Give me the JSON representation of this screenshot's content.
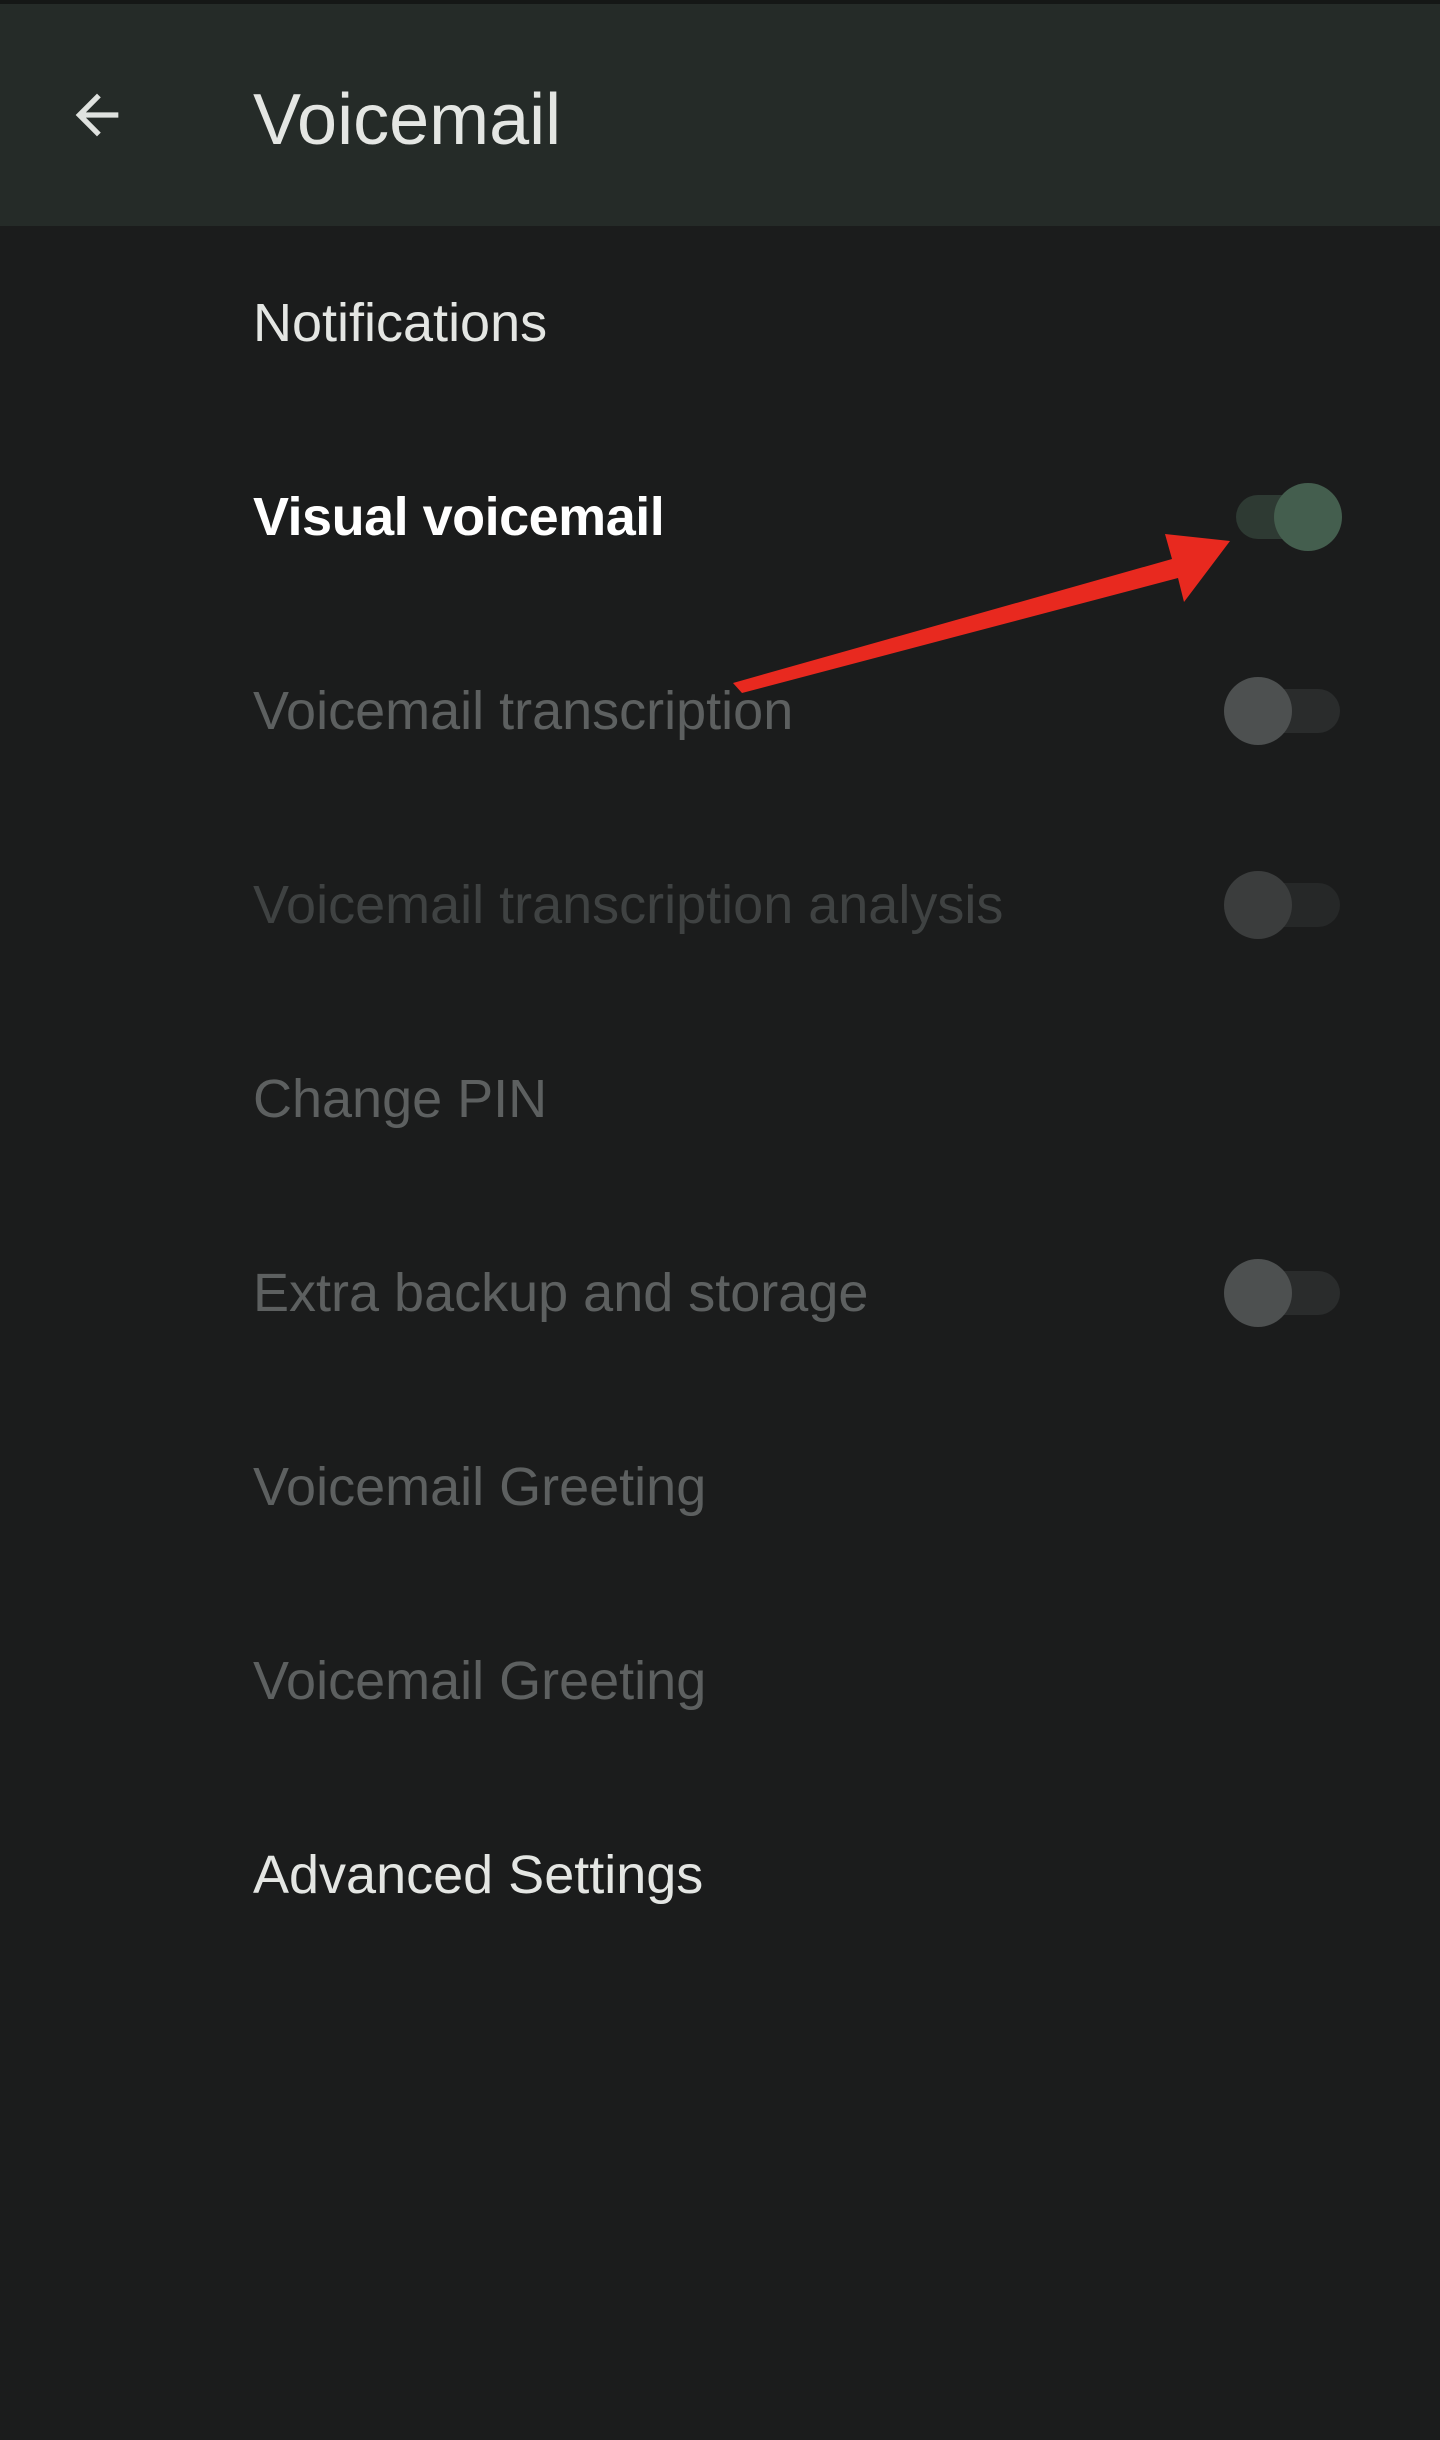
{
  "app_bar": {
    "title": "Voicemail",
    "back_icon": "arrow-back-icon"
  },
  "settings": {
    "notifications": {
      "label": "Notifications"
    },
    "visual_voicemail": {
      "label": "Visual voicemail",
      "enabled": true
    },
    "voicemail_transcription": {
      "label": "Voicemail transcription",
      "enabled": false
    },
    "voicemail_transcription_analysis": {
      "label": "Voicemail transcription analysis",
      "enabled": false
    },
    "change_pin": {
      "label": "Change PIN"
    },
    "extra_backup": {
      "label": "Extra backup and storage",
      "enabled": false
    },
    "greeting_1": {
      "label": "Voicemail Greeting"
    },
    "greeting_2": {
      "label": "Voicemail Greeting"
    },
    "advanced": {
      "label": "Advanced Settings"
    }
  },
  "colors": {
    "background": "#1b1c1c",
    "app_bar": "#252b28",
    "switch_on_thumb": "#445e4e",
    "annotation_arrow": "#e8291f"
  }
}
